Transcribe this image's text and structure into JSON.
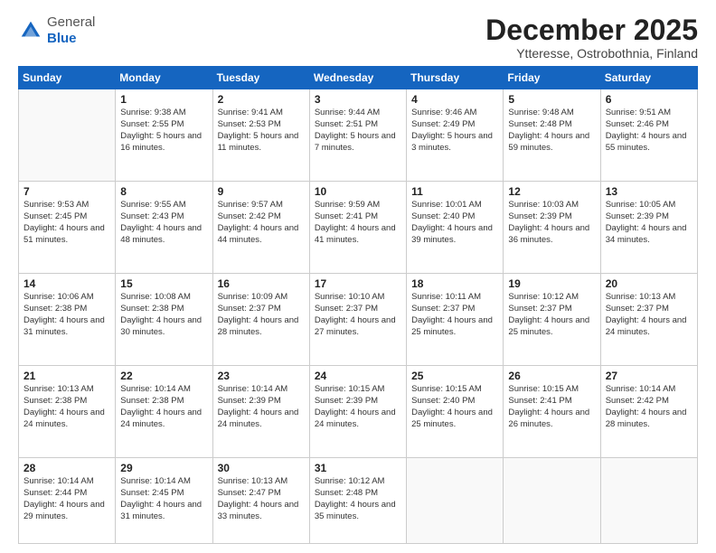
{
  "logo": {
    "general": "General",
    "blue": "Blue"
  },
  "header": {
    "month": "December 2025",
    "location": "Ytteresse, Ostrobothnia, Finland"
  },
  "weekdays": [
    "Sunday",
    "Monday",
    "Tuesday",
    "Wednesday",
    "Thursday",
    "Friday",
    "Saturday"
  ],
  "weeks": [
    [
      {
        "day": "",
        "empty": true
      },
      {
        "day": "1",
        "sunrise": "Sunrise: 9:38 AM",
        "sunset": "Sunset: 2:55 PM",
        "daylight": "Daylight: 5 hours and 16 minutes."
      },
      {
        "day": "2",
        "sunrise": "Sunrise: 9:41 AM",
        "sunset": "Sunset: 2:53 PM",
        "daylight": "Daylight: 5 hours and 11 minutes."
      },
      {
        "day": "3",
        "sunrise": "Sunrise: 9:44 AM",
        "sunset": "Sunset: 2:51 PM",
        "daylight": "Daylight: 5 hours and 7 minutes."
      },
      {
        "day": "4",
        "sunrise": "Sunrise: 9:46 AM",
        "sunset": "Sunset: 2:49 PM",
        "daylight": "Daylight: 5 hours and 3 minutes."
      },
      {
        "day": "5",
        "sunrise": "Sunrise: 9:48 AM",
        "sunset": "Sunset: 2:48 PM",
        "daylight": "Daylight: 4 hours and 59 minutes."
      },
      {
        "day": "6",
        "sunrise": "Sunrise: 9:51 AM",
        "sunset": "Sunset: 2:46 PM",
        "daylight": "Daylight: 4 hours and 55 minutes."
      }
    ],
    [
      {
        "day": "7",
        "sunrise": "Sunrise: 9:53 AM",
        "sunset": "Sunset: 2:45 PM",
        "daylight": "Daylight: 4 hours and 51 minutes."
      },
      {
        "day": "8",
        "sunrise": "Sunrise: 9:55 AM",
        "sunset": "Sunset: 2:43 PM",
        "daylight": "Daylight: 4 hours and 48 minutes."
      },
      {
        "day": "9",
        "sunrise": "Sunrise: 9:57 AM",
        "sunset": "Sunset: 2:42 PM",
        "daylight": "Daylight: 4 hours and 44 minutes."
      },
      {
        "day": "10",
        "sunrise": "Sunrise: 9:59 AM",
        "sunset": "Sunset: 2:41 PM",
        "daylight": "Daylight: 4 hours and 41 minutes."
      },
      {
        "day": "11",
        "sunrise": "Sunrise: 10:01 AM",
        "sunset": "Sunset: 2:40 PM",
        "daylight": "Daylight: 4 hours and 39 minutes."
      },
      {
        "day": "12",
        "sunrise": "Sunrise: 10:03 AM",
        "sunset": "Sunset: 2:39 PM",
        "daylight": "Daylight: 4 hours and 36 minutes."
      },
      {
        "day": "13",
        "sunrise": "Sunrise: 10:05 AM",
        "sunset": "Sunset: 2:39 PM",
        "daylight": "Daylight: 4 hours and 34 minutes."
      }
    ],
    [
      {
        "day": "14",
        "sunrise": "Sunrise: 10:06 AM",
        "sunset": "Sunset: 2:38 PM",
        "daylight": "Daylight: 4 hours and 31 minutes."
      },
      {
        "day": "15",
        "sunrise": "Sunrise: 10:08 AM",
        "sunset": "Sunset: 2:38 PM",
        "daylight": "Daylight: 4 hours and 30 minutes."
      },
      {
        "day": "16",
        "sunrise": "Sunrise: 10:09 AM",
        "sunset": "Sunset: 2:37 PM",
        "daylight": "Daylight: 4 hours and 28 minutes."
      },
      {
        "day": "17",
        "sunrise": "Sunrise: 10:10 AM",
        "sunset": "Sunset: 2:37 PM",
        "daylight": "Daylight: 4 hours and 27 minutes."
      },
      {
        "day": "18",
        "sunrise": "Sunrise: 10:11 AM",
        "sunset": "Sunset: 2:37 PM",
        "daylight": "Daylight: 4 hours and 25 minutes."
      },
      {
        "day": "19",
        "sunrise": "Sunrise: 10:12 AM",
        "sunset": "Sunset: 2:37 PM",
        "daylight": "Daylight: 4 hours and 25 minutes."
      },
      {
        "day": "20",
        "sunrise": "Sunrise: 10:13 AM",
        "sunset": "Sunset: 2:37 PM",
        "daylight": "Daylight: 4 hours and 24 minutes."
      }
    ],
    [
      {
        "day": "21",
        "sunrise": "Sunrise: 10:13 AM",
        "sunset": "Sunset: 2:38 PM",
        "daylight": "Daylight: 4 hours and 24 minutes."
      },
      {
        "day": "22",
        "sunrise": "Sunrise: 10:14 AM",
        "sunset": "Sunset: 2:38 PM",
        "daylight": "Daylight: 4 hours and 24 minutes."
      },
      {
        "day": "23",
        "sunrise": "Sunrise: 10:14 AM",
        "sunset": "Sunset: 2:39 PM",
        "daylight": "Daylight: 4 hours and 24 minutes."
      },
      {
        "day": "24",
        "sunrise": "Sunrise: 10:15 AM",
        "sunset": "Sunset: 2:39 PM",
        "daylight": "Daylight: 4 hours and 24 minutes."
      },
      {
        "day": "25",
        "sunrise": "Sunrise: 10:15 AM",
        "sunset": "Sunset: 2:40 PM",
        "daylight": "Daylight: 4 hours and 25 minutes."
      },
      {
        "day": "26",
        "sunrise": "Sunrise: 10:15 AM",
        "sunset": "Sunset: 2:41 PM",
        "daylight": "Daylight: 4 hours and 26 minutes."
      },
      {
        "day": "27",
        "sunrise": "Sunrise: 10:14 AM",
        "sunset": "Sunset: 2:42 PM",
        "daylight": "Daylight: 4 hours and 28 minutes."
      }
    ],
    [
      {
        "day": "28",
        "sunrise": "Sunrise: 10:14 AM",
        "sunset": "Sunset: 2:44 PM",
        "daylight": "Daylight: 4 hours and 29 minutes."
      },
      {
        "day": "29",
        "sunrise": "Sunrise: 10:14 AM",
        "sunset": "Sunset: 2:45 PM",
        "daylight": "Daylight: 4 hours and 31 minutes."
      },
      {
        "day": "30",
        "sunrise": "Sunrise: 10:13 AM",
        "sunset": "Sunset: 2:47 PM",
        "daylight": "Daylight: 4 hours and 33 minutes."
      },
      {
        "day": "31",
        "sunrise": "Sunrise: 10:12 AM",
        "sunset": "Sunset: 2:48 PM",
        "daylight": "Daylight: 4 hours and 35 minutes."
      },
      {
        "day": "",
        "empty": true
      },
      {
        "day": "",
        "empty": true
      },
      {
        "day": "",
        "empty": true
      }
    ]
  ]
}
